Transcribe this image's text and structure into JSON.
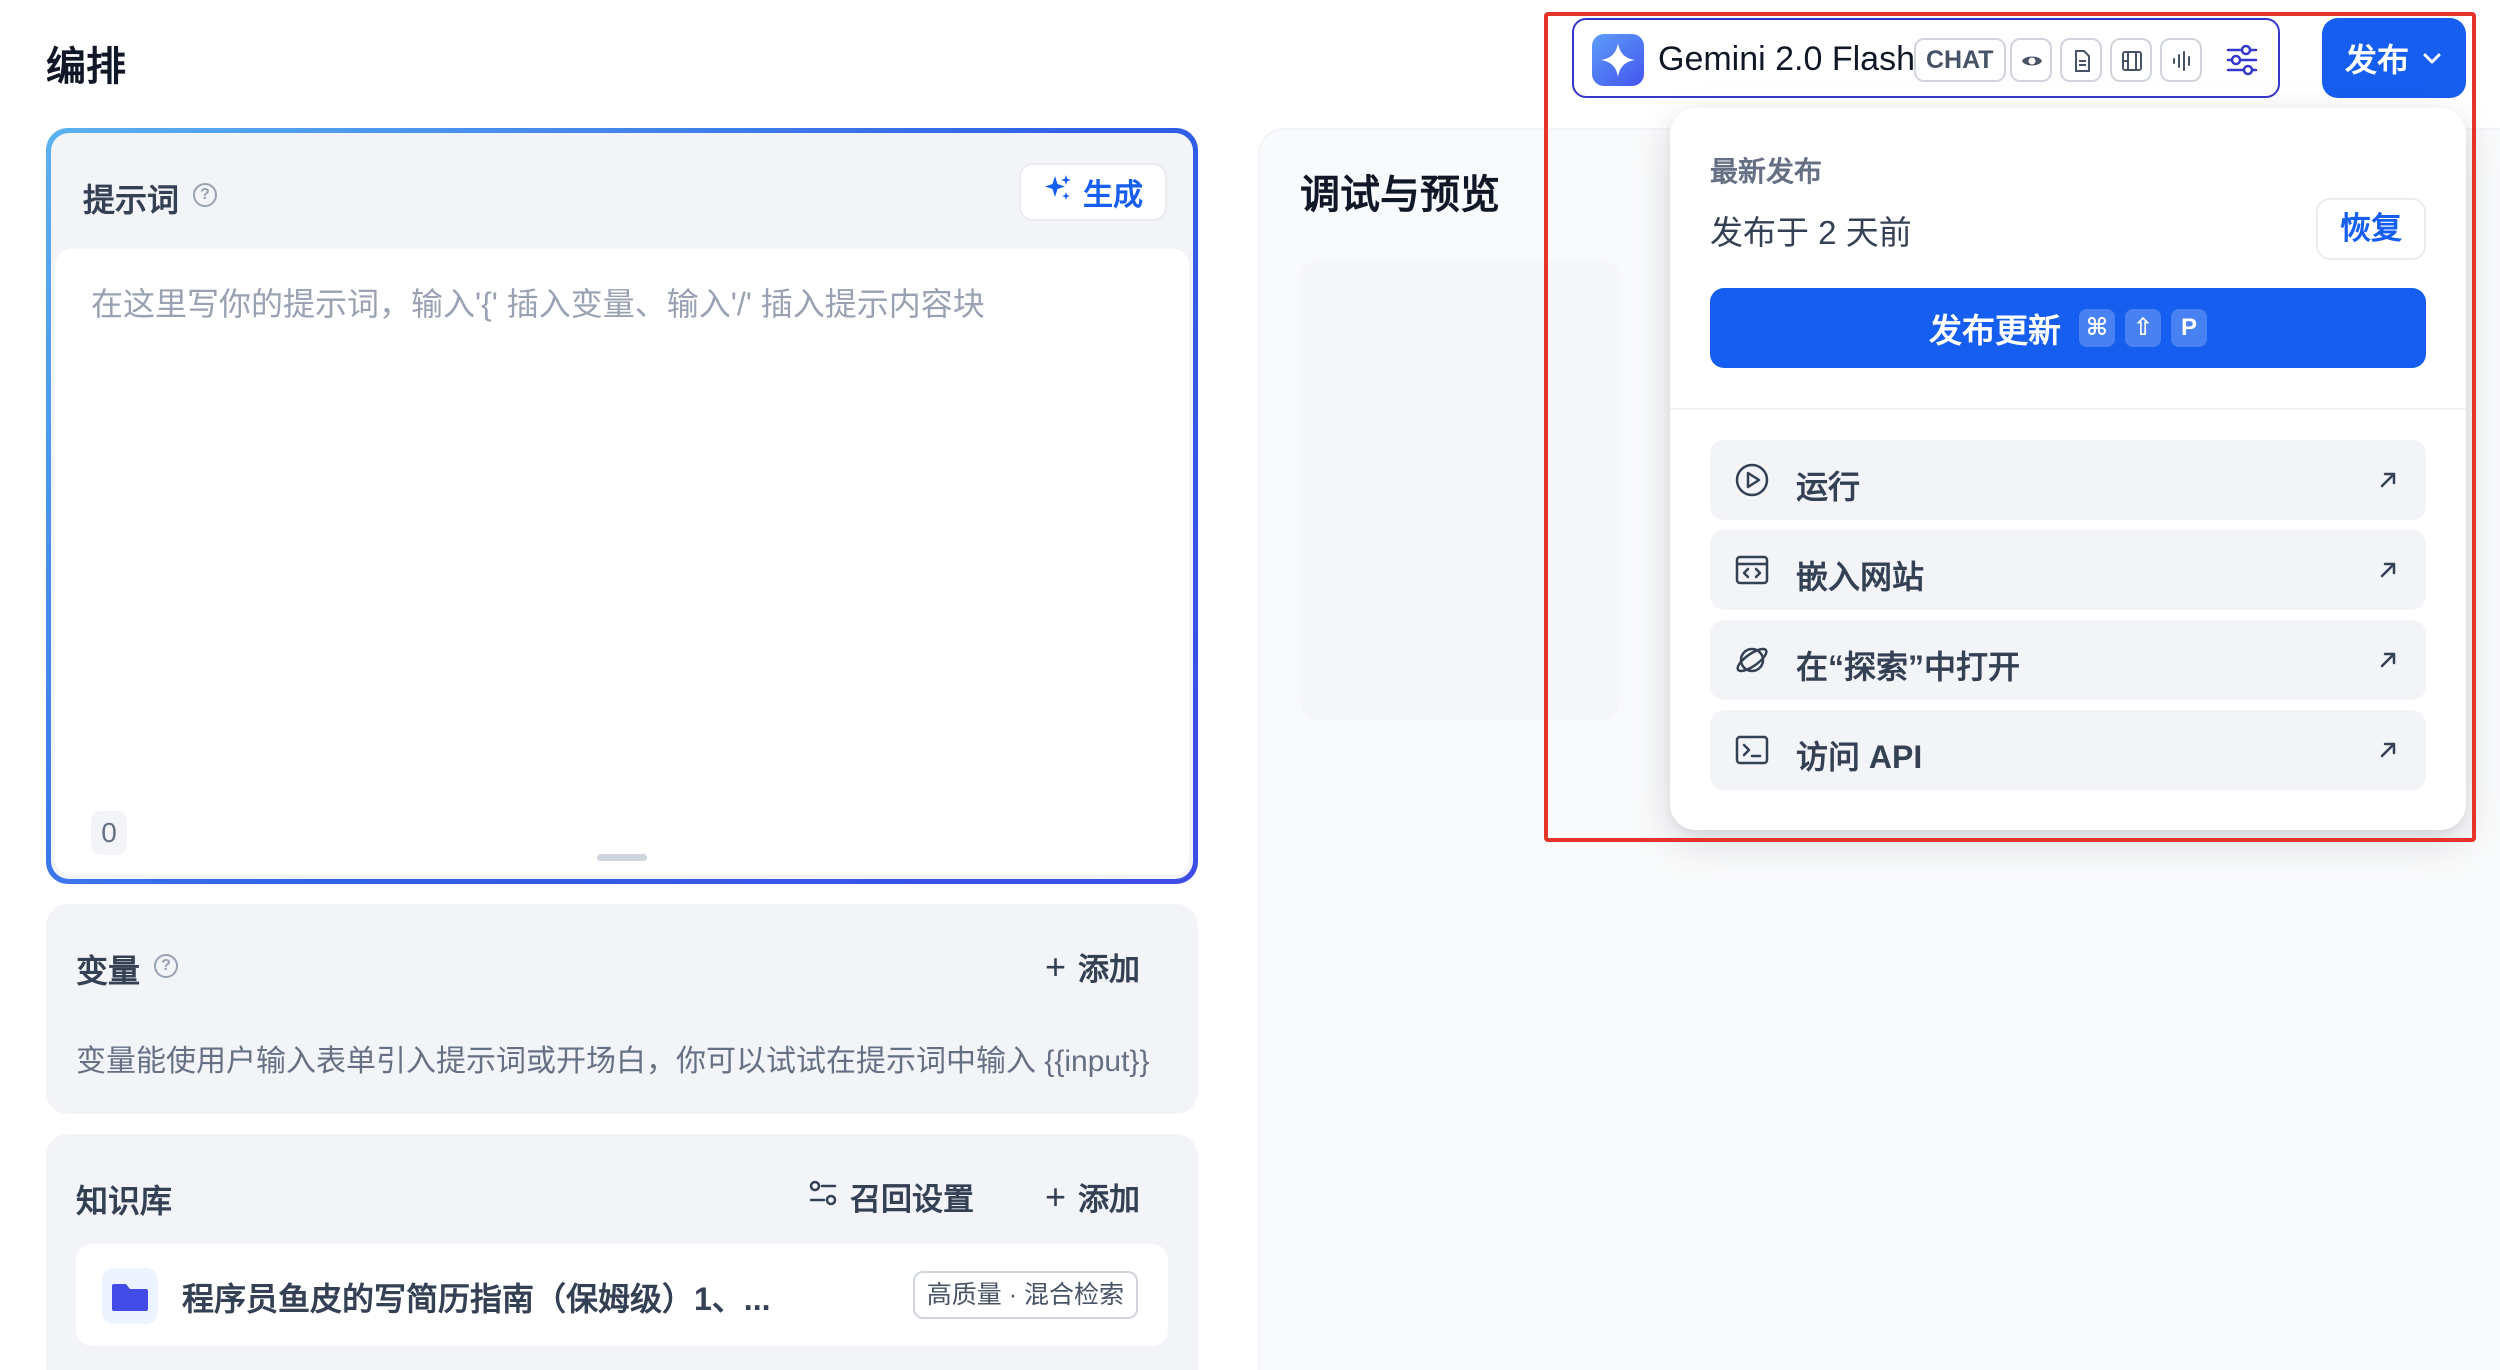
{
  "page": {
    "title": "编排"
  },
  "prompt": {
    "label": "提示词",
    "help_icon": "?",
    "generate_label": "生成",
    "placeholder": "在这里写你的提示词，输入'{' 插入变量、输入'/' 插入提示内容块",
    "char_count": "0"
  },
  "variables": {
    "title": "变量",
    "help_icon": "?",
    "add_label": "添加",
    "add_symbol": "+",
    "description": "变量能使用户输入表单引入提示词或开场白，你可以试试在提示词中输入 {{input}}"
  },
  "knowledge": {
    "title": "知识库",
    "recall_label": "召回设置",
    "add_label": "添加",
    "add_symbol": "+",
    "items": [
      {
        "name": "程序员鱼皮的写简历指南（保姆级）1、...",
        "badge": "高质量 · 混合检索"
      }
    ]
  },
  "preview": {
    "title": "调试与预览"
  },
  "model": {
    "name": "Gemini 2.0 Flash",
    "mode_tag": "CHAT",
    "capabilities": [
      "eye-icon",
      "document-icon",
      "video-icon",
      "audio-icon"
    ]
  },
  "publish": {
    "button_label": "发布",
    "dropdown": {
      "section_label": "最新发布",
      "published_when": "发布于 2 天前",
      "restore_label": "恢复",
      "update_label": "发布更新",
      "shortcut": [
        "⌘",
        "⇧",
        "P"
      ],
      "items": [
        {
          "label": "运行",
          "icon": "play-circle-icon"
        },
        {
          "label": "嵌入网站",
          "icon": "embed-code-icon"
        },
        {
          "label": "在“探索”中打开",
          "icon": "explore-planet-icon"
        },
        {
          "label": "访问 API",
          "icon": "terminal-icon"
        }
      ]
    }
  },
  "colors": {
    "accent": "#155eef",
    "highlight": "#e5352b"
  }
}
